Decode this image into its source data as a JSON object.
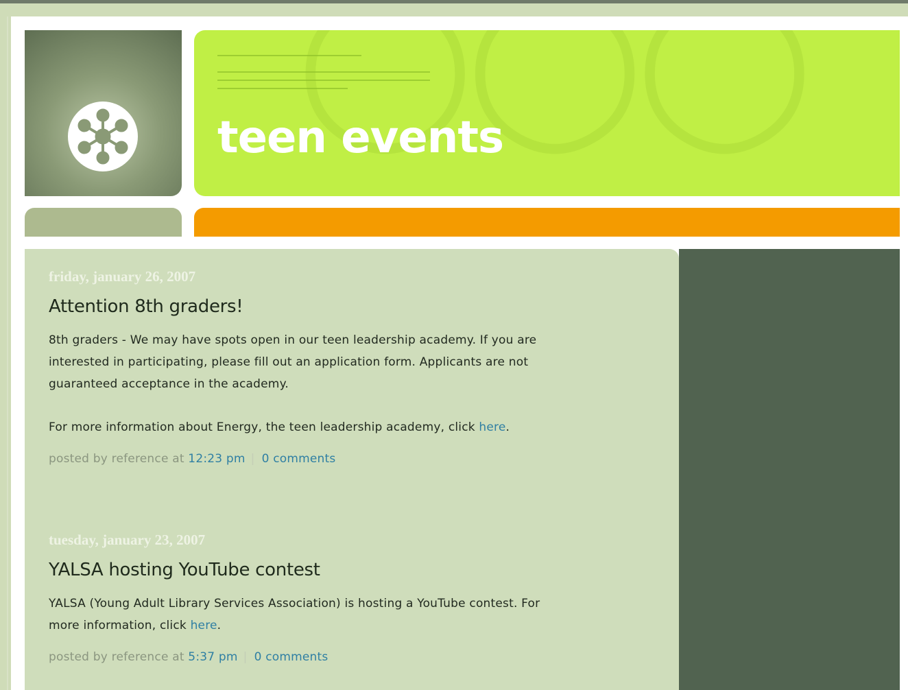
{
  "header": {
    "title": "teen events",
    "banner_color": "#c0ef45",
    "stripe_color": "#f49b00"
  },
  "posts": [
    {
      "date": "friday, january 26, 2007",
      "title": "Attention 8th graders!",
      "paragraph1": "8th graders - We may have spots open in our teen leadership academy. If you are interested in participating, please fill out an application form. Applicants are not guaranteed acceptance in the academy.",
      "paragraph2_prefix": "For more information about Energy, the teen leadership academy, click ",
      "link_text": "here",
      "paragraph2_suffix": ".",
      "meta_prefix": "posted by reference at ",
      "time": "12:23 pm",
      "comments": "0 comments"
    },
    {
      "date": "tuesday, january 23, 2007",
      "title": "YALSA hosting YouTube contest",
      "paragraph1_prefix": "YALSA (Young Adult Library Services Association) is hosting a YouTube contest. For more information, click ",
      "link_text": "here",
      "paragraph1_suffix": ".",
      "meta_prefix": "posted by reference at ",
      "time": "5:37 pm",
      "comments": "0 comments"
    }
  ]
}
